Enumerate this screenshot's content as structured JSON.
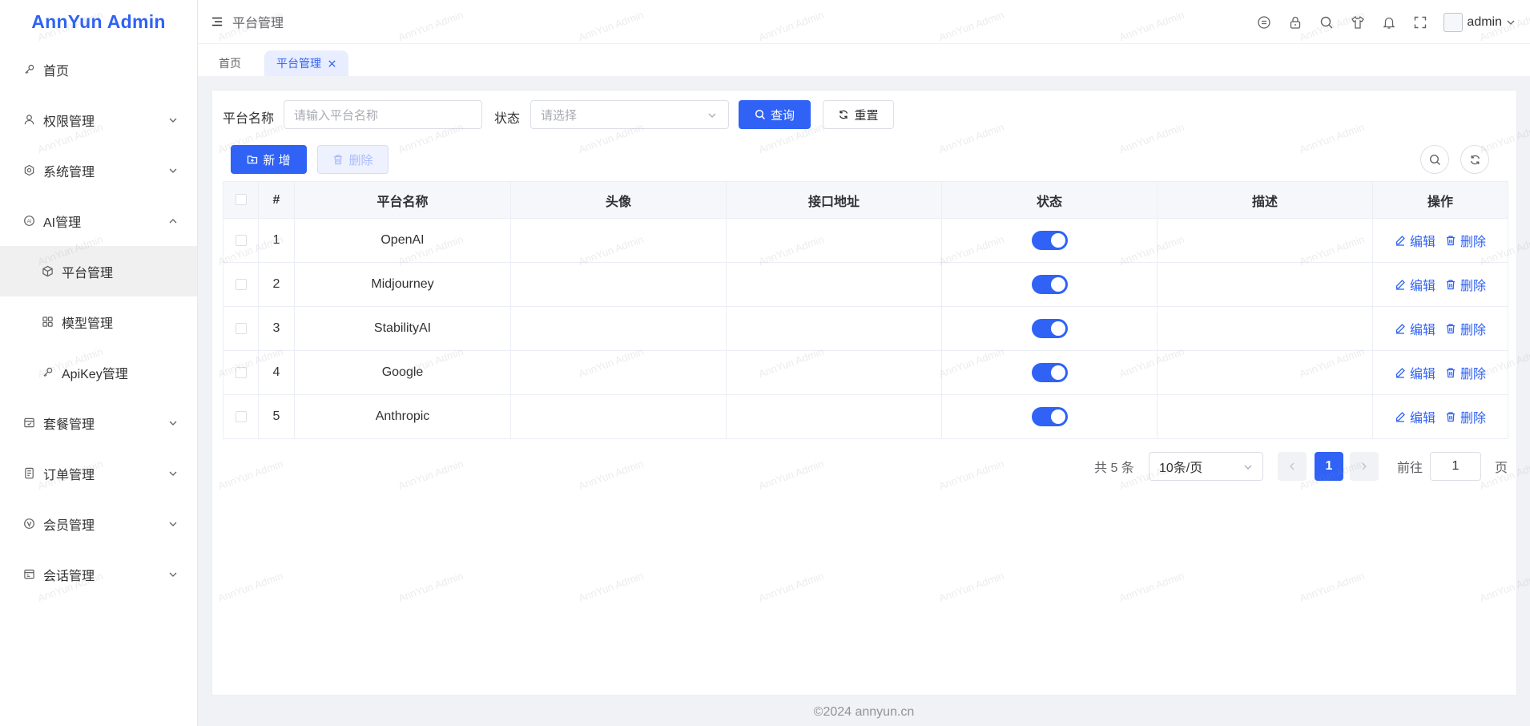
{
  "app": {
    "title": "AnnYun Admin"
  },
  "sidebar": {
    "items": [
      {
        "label": "首页",
        "icon": "key-icon"
      },
      {
        "label": "权限管理",
        "icon": "user-icon"
      },
      {
        "label": "系统管理",
        "icon": "gear-icon"
      },
      {
        "label": "AI管理",
        "icon": "ai-icon"
      },
      {
        "label": "平台管理",
        "icon": "box-icon"
      },
      {
        "label": "模型管理",
        "icon": "grid-icon"
      },
      {
        "label": "ApiKey管理",
        "icon": "key-icon"
      },
      {
        "label": "套餐管理",
        "icon": "package-icon"
      },
      {
        "label": "订单管理",
        "icon": "order-icon"
      },
      {
        "label": "会员管理",
        "icon": "vip-icon"
      },
      {
        "label": "会话管理",
        "icon": "chat-icon"
      }
    ]
  },
  "header": {
    "breadcrumb": "平台管理",
    "username": "admin"
  },
  "tabs": [
    {
      "label": "首页"
    },
    {
      "label": "平台管理"
    }
  ],
  "filters": {
    "name_label": "平台名称",
    "name_placeholder": "请输入平台名称",
    "status_label": "状态",
    "status_placeholder": "请选择",
    "search_button": "查询",
    "reset_button": "重置"
  },
  "toolbar": {
    "add_button": "新 增",
    "delete_button": "删除"
  },
  "table": {
    "headers": [
      "#",
      "平台名称",
      "头像",
      "接口地址",
      "状态",
      "描述",
      "操作"
    ],
    "rows": [
      {
        "index": "1",
        "name": "OpenAI",
        "avatar": "",
        "url": "",
        "status": true,
        "desc": ""
      },
      {
        "index": "2",
        "name": "Midjourney",
        "avatar": "",
        "url": "",
        "status": true,
        "desc": ""
      },
      {
        "index": "3",
        "name": "StabilityAI",
        "avatar": "",
        "url": "",
        "status": true,
        "desc": ""
      },
      {
        "index": "4",
        "name": "Google",
        "avatar": "",
        "url": "",
        "status": true,
        "desc": ""
      },
      {
        "index": "5",
        "name": "Anthropic",
        "avatar": "",
        "url": "",
        "status": true,
        "desc": ""
      }
    ],
    "edit_label": "编辑",
    "delete_label": "删除"
  },
  "pagination": {
    "total_text": "共 5 条",
    "page_size": "10条/页",
    "current_page": "1",
    "goto_label": "前往",
    "goto_value": "1",
    "page_suffix": "页"
  },
  "footer": {
    "text": "©2024 annyun.cn"
  },
  "colors": {
    "primary": "#2f62f5",
    "sidebar_active_bg": "#f0f0f1",
    "tab_active_bg": "#e8edff"
  }
}
